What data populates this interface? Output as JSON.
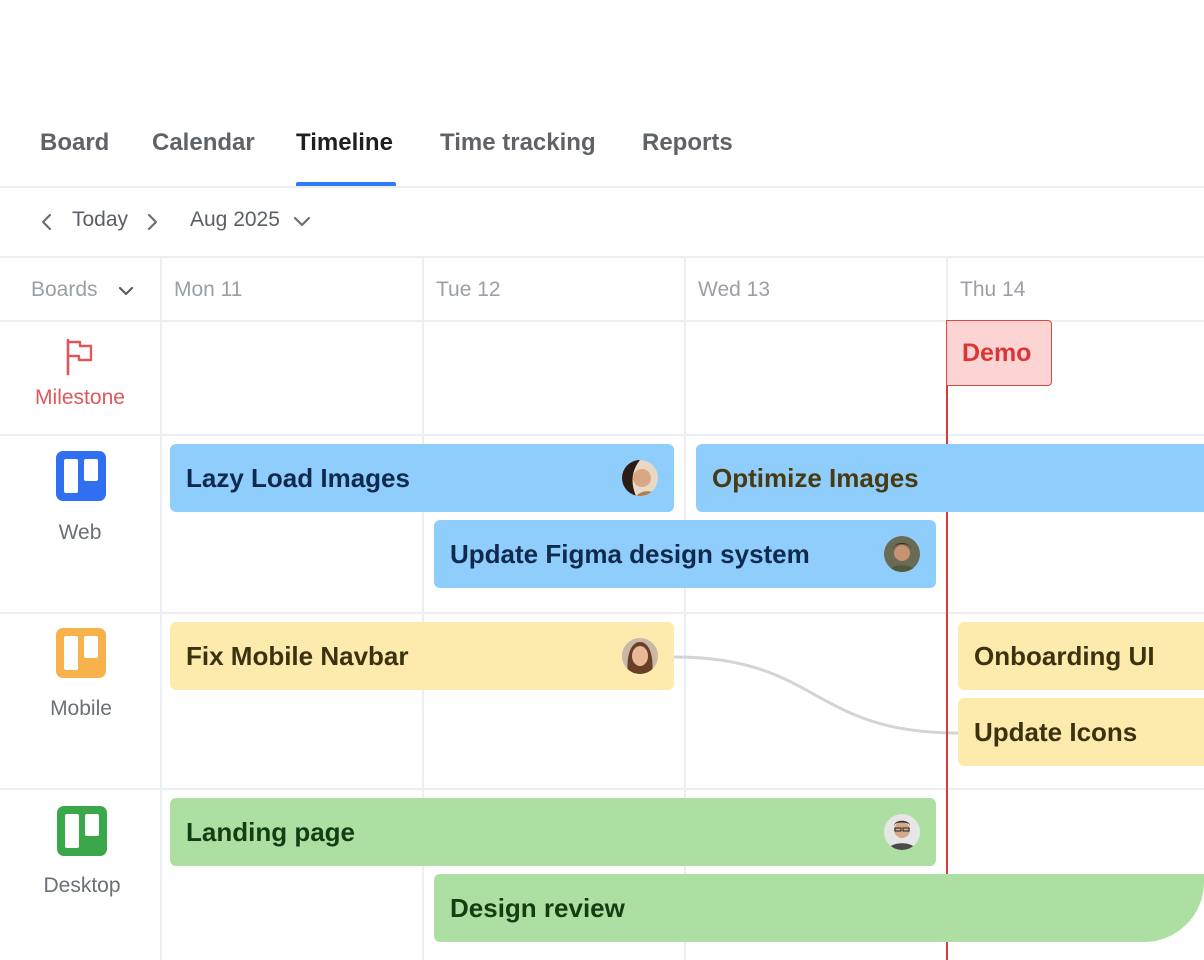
{
  "tabs": [
    {
      "label": "Board"
    },
    {
      "label": "Calendar"
    },
    {
      "label": "Timeline"
    },
    {
      "label": "Time tracking"
    },
    {
      "label": "Reports"
    }
  ],
  "active_tab": "Timeline",
  "nav": {
    "today_label": "Today",
    "month_label": "Aug 2025"
  },
  "boards_selector": {
    "label": "Boards"
  },
  "days": [
    {
      "label": "Mon 11"
    },
    {
      "label": "Tue 12"
    },
    {
      "label": "Wed 13"
    },
    {
      "label": "Thu 14"
    }
  ],
  "rows": [
    {
      "label": "Milestone",
      "icon": "flag-icon",
      "color": "#e0575a"
    },
    {
      "label": "Web",
      "icon": "board-icon",
      "color": "#2f6ff0"
    },
    {
      "label": "Mobile",
      "icon": "board-icon",
      "color": "#f7b24c"
    },
    {
      "label": "Desktop",
      "icon": "board-icon",
      "color": "#3aa84a"
    }
  ],
  "milestone": {
    "label": "Demo"
  },
  "tasks": {
    "lazy_load": {
      "label": "Lazy Load Images"
    },
    "optimize": {
      "label": "Optimize Images"
    },
    "figma": {
      "label": "Update Figma design system"
    },
    "navbar": {
      "label": "Fix Mobile Navbar"
    },
    "onboarding": {
      "label": "Onboarding UI"
    },
    "icons": {
      "label": "Update Icons"
    },
    "landing": {
      "label": "Landing page"
    },
    "review": {
      "label": "Design review"
    }
  },
  "colors": {
    "accent": "#2f7bf5",
    "today_line": "#d93a3a",
    "web_task": "#8fcdfd",
    "mobile_task": "#fdeaad",
    "desktop_task": "#aedfa2",
    "milestone_fill": "#fdd4d4"
  }
}
